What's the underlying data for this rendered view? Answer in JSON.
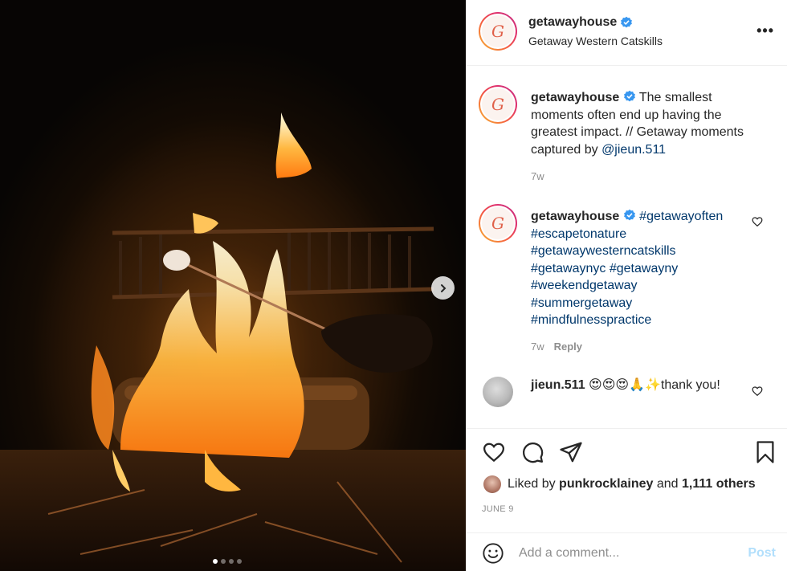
{
  "post": {
    "username": "getawayhouse",
    "location": "Getaway Western Catskills",
    "avatar_letter": "G",
    "more_icon": "more-horizontal-icon"
  },
  "caption": {
    "username": "getawayhouse",
    "text": "The smallest moments often end up having the greatest impact. // Getaway moments captured by",
    "mention": "@jieun.511",
    "time": "7w"
  },
  "comments": [
    {
      "username": "getawayhouse",
      "hashtags": [
        "#getawayoften",
        "#escapetonature",
        "#getawaywesterncatskills",
        "#getawaynyc",
        "#getawayny",
        "#weekendgetaway",
        "#summergetaway",
        "#mindfulnesspractice"
      ],
      "time": "7w",
      "reply_label": "Reply"
    },
    {
      "username": "jieun.511",
      "emojis": "😍😍😍🙏✨",
      "text": "thank you!"
    }
  ],
  "actions": {
    "liked_by_prefix": "Liked by",
    "liked_by_user": "punkrocklainey",
    "and_word": "and",
    "others": "1,111 others",
    "date": "JUNE 9"
  },
  "add_comment": {
    "placeholder": "Add a comment...",
    "post_label": "Post"
  },
  "colors": {
    "link": "#00376b",
    "verified": "#3897f0",
    "post_disabled": "#b2dffc"
  },
  "carousel": {
    "slide_count": 4,
    "active_index": 0
  }
}
